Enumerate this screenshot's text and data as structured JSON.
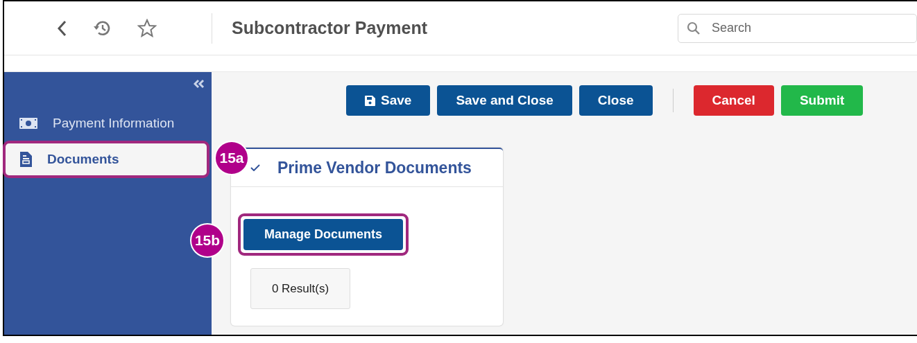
{
  "header": {
    "title": "Subcontractor Payment",
    "search": {
      "placeholder": "Search"
    }
  },
  "sidebar": {
    "items": [
      {
        "label": "Payment Information",
        "selected": false,
        "highlighted": false
      },
      {
        "label": "Documents",
        "selected": true,
        "highlighted": true
      }
    ]
  },
  "toolbar": {
    "buttons": [
      {
        "label": "Save",
        "kind": "primary"
      },
      {
        "label": "Save and Close",
        "kind": "primary"
      },
      {
        "label": "Close",
        "kind": "primary"
      },
      {
        "label": "Cancel",
        "kind": "danger"
      },
      {
        "label": "Submit",
        "kind": "success"
      }
    ]
  },
  "section": {
    "title": "Prime Vendor Documents",
    "expanded": true,
    "button": {
      "label": "Manage Documents",
      "highlighted": true
    },
    "result_count": "0 Result(s)"
  },
  "callouts": [
    {
      "label": "15a"
    },
    {
      "label": "15b"
    }
  ]
}
